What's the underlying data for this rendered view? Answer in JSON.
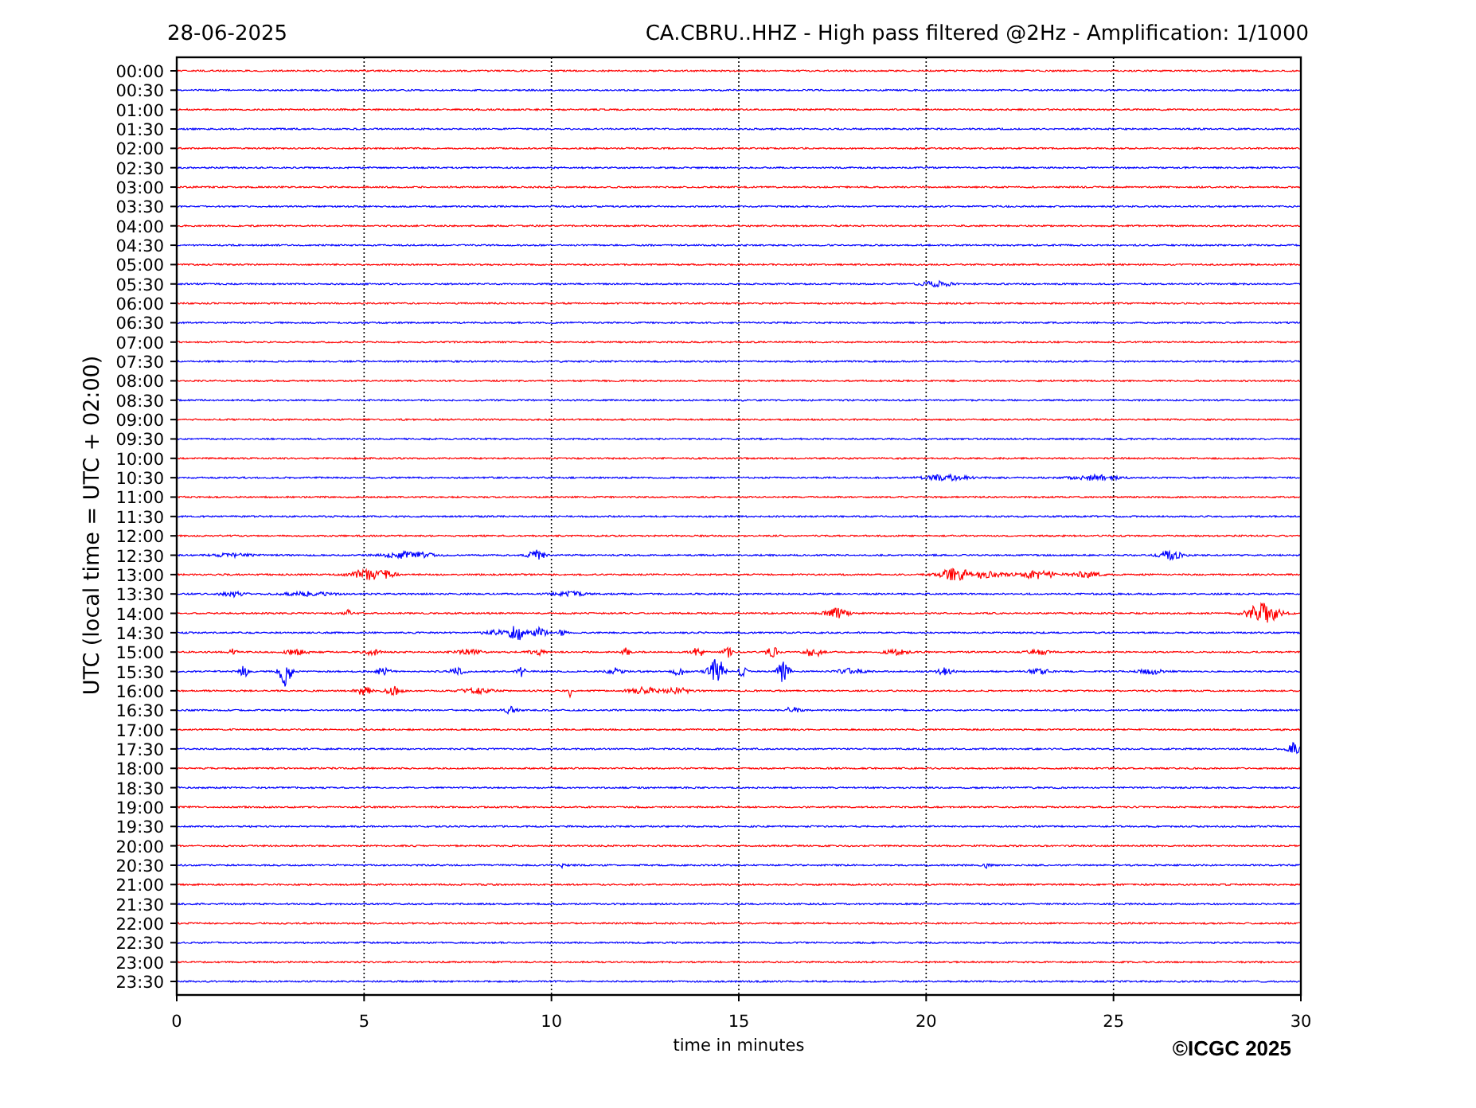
{
  "date": "28-06-2025",
  "title": "CA.CBRU..HHZ - High pass filtered @2Hz - Amplification: 1/1000",
  "y_axis": {
    "label": "UTC (local time = UTC + 02:00)"
  },
  "rows": [
    {
      "label": "00:00",
      "color": "#ff0000"
    },
    {
      "label": "00:30",
      "color": "#0000ff"
    },
    {
      "label": "01:00",
      "color": "#ff0000"
    },
    {
      "label": "01:30",
      "color": "#0000ff"
    },
    {
      "label": "02:00",
      "color": "#ff0000"
    },
    {
      "label": "02:30",
      "color": "#0000ff"
    },
    {
      "label": "03:00",
      "color": "#ff0000"
    },
    {
      "label": "03:30",
      "color": "#0000ff"
    },
    {
      "label": "04:00",
      "color": "#ff0000"
    },
    {
      "label": "04:30",
      "color": "#0000ff"
    },
    {
      "label": "05:00",
      "color": "#ff0000"
    },
    {
      "label": "05:30",
      "color": "#0000ff"
    },
    {
      "label": "06:00",
      "color": "#ff0000"
    },
    {
      "label": "06:30",
      "color": "#0000ff"
    },
    {
      "label": "07:00",
      "color": "#ff0000"
    },
    {
      "label": "07:30",
      "color": "#0000ff"
    },
    {
      "label": "08:00",
      "color": "#ff0000"
    },
    {
      "label": "08:30",
      "color": "#0000ff"
    },
    {
      "label": "09:00",
      "color": "#ff0000"
    },
    {
      "label": "09:30",
      "color": "#0000ff"
    },
    {
      "label": "10:00",
      "color": "#ff0000"
    },
    {
      "label": "10:30",
      "color": "#0000ff"
    },
    {
      "label": "11:00",
      "color": "#ff0000"
    },
    {
      "label": "11:30",
      "color": "#0000ff"
    },
    {
      "label": "12:00",
      "color": "#ff0000"
    },
    {
      "label": "12:30",
      "color": "#0000ff"
    },
    {
      "label": "13:00",
      "color": "#ff0000"
    },
    {
      "label": "13:30",
      "color": "#0000ff"
    },
    {
      "label": "14:00",
      "color": "#ff0000"
    },
    {
      "label": "14:30",
      "color": "#0000ff"
    },
    {
      "label": "15:00",
      "color": "#ff0000"
    },
    {
      "label": "15:30",
      "color": "#0000ff"
    },
    {
      "label": "16:00",
      "color": "#ff0000"
    },
    {
      "label": "16:30",
      "color": "#0000ff"
    },
    {
      "label": "17:00",
      "color": "#ff0000"
    },
    {
      "label": "17:30",
      "color": "#0000ff"
    },
    {
      "label": "18:00",
      "color": "#ff0000"
    },
    {
      "label": "18:30",
      "color": "#0000ff"
    },
    {
      "label": "19:00",
      "color": "#ff0000"
    },
    {
      "label": "19:30",
      "color": "#0000ff"
    },
    {
      "label": "20:00",
      "color": "#ff0000"
    },
    {
      "label": "20:30",
      "color": "#0000ff"
    },
    {
      "label": "21:00",
      "color": "#ff0000"
    },
    {
      "label": "21:30",
      "color": "#0000ff"
    },
    {
      "label": "22:00",
      "color": "#ff0000"
    },
    {
      "label": "22:30",
      "color": "#0000ff"
    },
    {
      "label": "23:00",
      "color": "#ff0000"
    },
    {
      "label": "23:30",
      "color": "#0000ff"
    }
  ],
  "x_axis": {
    "label": "time in minutes",
    "ticks": [
      "0",
      "5",
      "10",
      "15",
      "20",
      "25",
      "30"
    ]
  },
  "copyright": "©ICGC 2025"
}
